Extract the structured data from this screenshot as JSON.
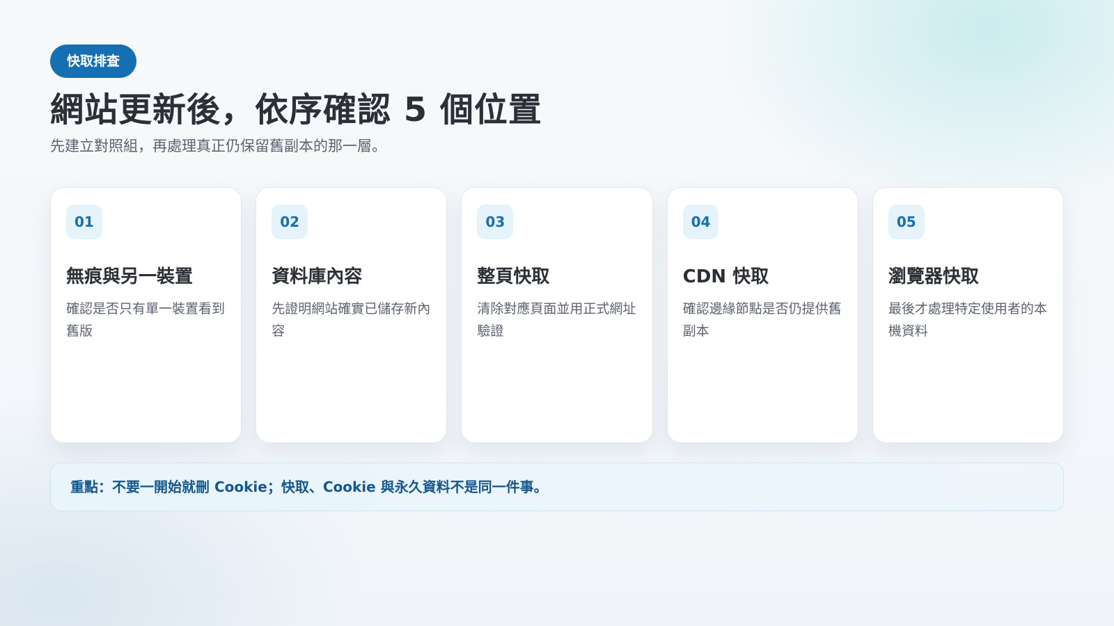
{
  "header": {
    "badge": "快取排查",
    "title": "網站更新後，依序確認 5 個位置",
    "subtitle": "先建立對照組，再處理真正仍保留舊副本的那一層。"
  },
  "cards": [
    {
      "number": "01",
      "title": "無痕與另一裝置",
      "description": "確認是否只有單一裝置看到舊版"
    },
    {
      "number": "02",
      "title": "資料庫內容",
      "description": "先證明網站確實已儲存新內容"
    },
    {
      "number": "03",
      "title": "整頁快取",
      "description": "清除對應頁面並用正式網址驗證"
    },
    {
      "number": "04",
      "title": "CDN 快取",
      "description": "確認邊緣節點是否仍提供舊副本"
    },
    {
      "number": "05",
      "title": "瀏覽器快取",
      "description": "最後才處理特定使用者的本機資料"
    }
  ],
  "note": {
    "text": "重點：不要一開始就刪 Cookie；快取、Cookie 與永久資料不是同一件事。"
  },
  "colors": {
    "accent": "#1570b3",
    "accent_light": "#e6f3fb",
    "title_text": "#2b2f36",
    "body_text": "#5d6470",
    "note_text": "#15578f"
  }
}
